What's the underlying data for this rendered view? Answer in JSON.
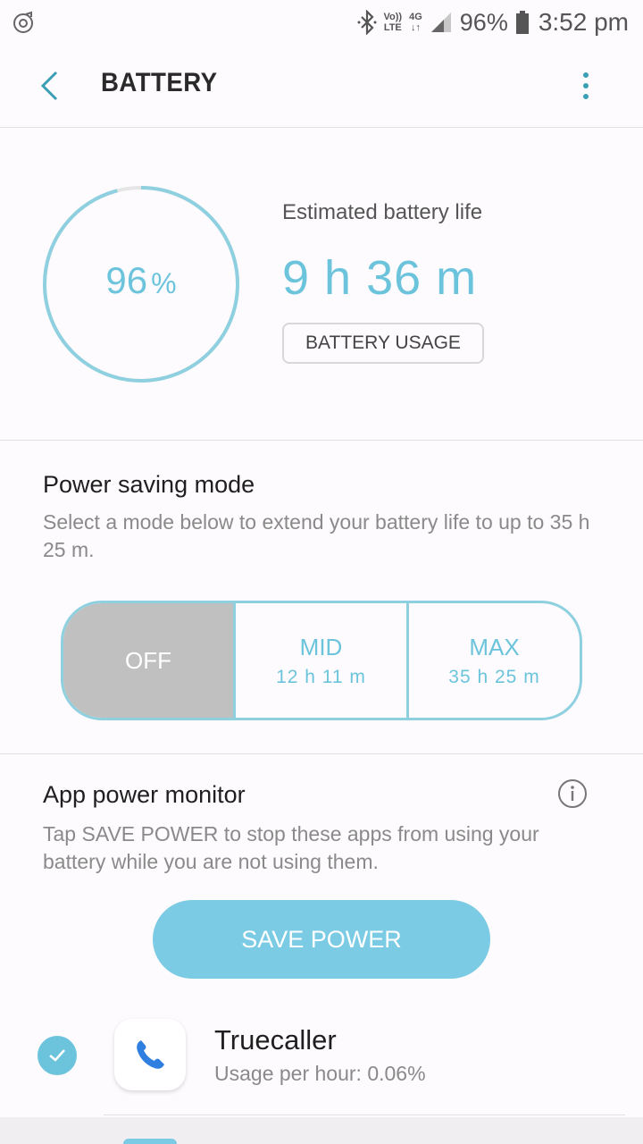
{
  "status_bar": {
    "left_icon": "music-player-icon",
    "bluetooth_icon": "bluetooth-icon",
    "volte_line1": "Vo))",
    "volte_line2": "LTE",
    "network": "4G",
    "network_arrows": "↓↑",
    "signal_icon": "signal-icon",
    "battery_percent": "96%",
    "battery_icon": "battery-icon",
    "time": "3:52 pm"
  },
  "appbar": {
    "back_icon": "back-arrow-icon",
    "title": "BATTERY",
    "more_icon": "more-vert-icon"
  },
  "battery": {
    "level": 96,
    "level_number": "96",
    "level_unit": "%",
    "estimated_label": "Estimated battery life",
    "estimated_value": "9 h 36 m",
    "usage_button": "BATTERY USAGE"
  },
  "power_saving": {
    "title": "Power saving mode",
    "description": "Select a mode below to extend your battery life to up to 35 h 25 m.",
    "modes": [
      {
        "name": "OFF",
        "time": "",
        "selected": true
      },
      {
        "name": "MID",
        "time": "12 h 11 m",
        "selected": false
      },
      {
        "name": "MAX",
        "time": "35 h 25 m",
        "selected": false
      }
    ]
  },
  "app_power_monitor": {
    "title": "App power monitor",
    "info_icon": "info-icon",
    "description": "Tap SAVE POWER to stop these apps from using your battery while you are not using them.",
    "save_button": "SAVE POWER",
    "apps": [
      {
        "name": "Truecaller",
        "usage": "Usage per hour: 0.06%",
        "checked": true,
        "icon": "phone-icon"
      }
    ]
  },
  "colors": {
    "accent": "#6cc4dc",
    "accent_dark": "#3a9fb5",
    "save_button": "#7ccbe4",
    "selected_mode": "#c0c0c0",
    "background": "#fdfbfd"
  }
}
